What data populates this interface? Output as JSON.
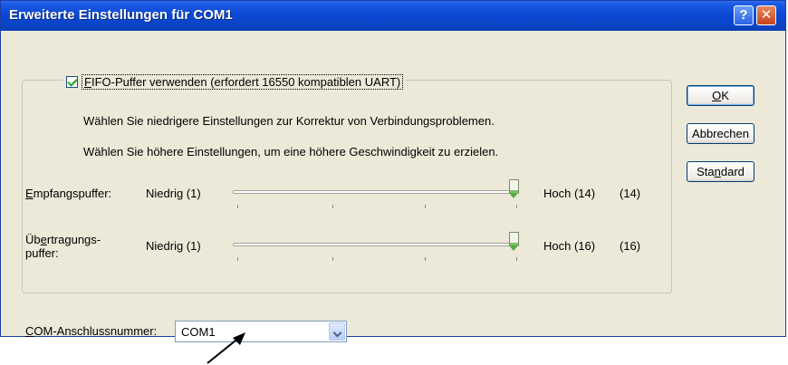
{
  "window": {
    "title": "Erweiterte Einstellungen für COM1",
    "help_symbol": "?",
    "close_symbol": "✕"
  },
  "fifo": {
    "checked": true,
    "label_first": "F",
    "label_rest": "IFO-Puffer verwenden (erfordert 16550 kompatiblen UART)"
  },
  "hints": {
    "lower": "Wählen Sie niedrigere Einstellungen zur Korrektur von Verbindungsproblemen.",
    "higher": "Wählen Sie höhere Einstellungen, um eine höhere Geschwindigkeit zu erzielen."
  },
  "receive_buffer": {
    "label_first": "E",
    "label_rest": "mpfangspuffer:",
    "min_label": "Niedrig (1)",
    "max_label": "Hoch (14)",
    "value_display": "(14)",
    "min": 1,
    "max": 14,
    "value": 14
  },
  "transmit_buffer": {
    "label_line1_pre": "Üb",
    "label_line1_ul": "e",
    "label_line1_post": "rtragungs-",
    "label_line2": "puffer:",
    "min_label": "Niedrig (1)",
    "max_label": "Hoch (16)",
    "value_display": "(16)",
    "min": 1,
    "max": 16,
    "value": 16
  },
  "buttons": {
    "ok_ul": "O",
    "ok_rest": "K",
    "cancel": "Abbrechen",
    "default_pre": "Sta",
    "default_ul": "n",
    "default_post": "dard"
  },
  "com_port": {
    "label_first": "C",
    "label_rest": "OM-Anschlussnummer:",
    "value": "COM1"
  },
  "icons": {
    "help": "help-icon",
    "close": "close-icon",
    "dropdown": "chevron-down-icon",
    "annotation": "arrow-annotation-icon"
  },
  "colors": {
    "titlebar": "#0a46d2",
    "dialog_bg": "#ece9d8",
    "check": "#21a121",
    "slider_thumb": "#5aa84a"
  }
}
